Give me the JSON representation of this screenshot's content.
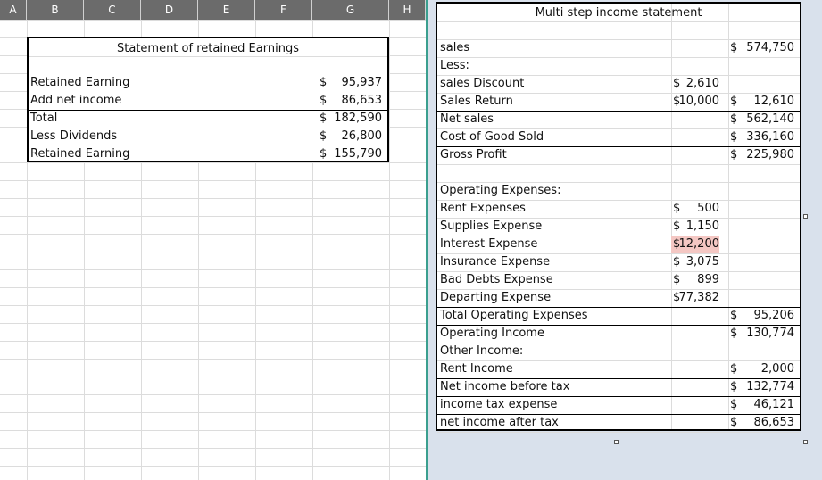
{
  "columns": [
    "A",
    "B",
    "C",
    "D",
    "E",
    "F",
    "G",
    "H"
  ],
  "retained": {
    "title": "Statement of retained Earnings",
    "rows": [
      {
        "label": "Retained Earning",
        "currency": "$",
        "value": "95,937"
      },
      {
        "label": "Add net income",
        "currency": "$",
        "value": "86,653"
      },
      {
        "label": "Total",
        "currency": "$",
        "value": "182,590"
      },
      {
        "label": "Less Dividends",
        "currency": "$",
        "value": "26,800"
      },
      {
        "label": "Retained Earning",
        "currency": "$",
        "value": "155,790"
      }
    ]
  },
  "income": {
    "title": "Multi step income statement",
    "rows": [
      {
        "label": "sales",
        "c1cur": "",
        "c1": "",
        "c2cur": "$",
        "c2": "574,750"
      },
      {
        "label": "Less:",
        "c1cur": "",
        "c1": "",
        "c2cur": "",
        "c2": ""
      },
      {
        "label": "sales Discount",
        "c1cur": "$",
        "c1": "2,610",
        "c2cur": "",
        "c2": ""
      },
      {
        "label": "Sales Return",
        "c1cur": "$",
        "c1": "10,000",
        "c2cur": "$",
        "c2": "12,610"
      },
      {
        "label": "Net sales",
        "c1cur": "",
        "c1": "",
        "c2cur": "$",
        "c2": "562,140"
      },
      {
        "label": "Cost of Good Sold",
        "c1cur": "",
        "c1": "",
        "c2cur": "$",
        "c2": "336,160"
      },
      {
        "label": "Gross Profit",
        "c1cur": "",
        "c1": "",
        "c2cur": "$",
        "c2": "225,980"
      },
      {
        "label": "",
        "c1cur": "",
        "c1": "",
        "c2cur": "",
        "c2": ""
      },
      {
        "label": "Operating Expenses:",
        "c1cur": "",
        "c1": "",
        "c2cur": "",
        "c2": ""
      },
      {
        "label": "Rent Expenses",
        "c1cur": "$",
        "c1": "500",
        "c2cur": "",
        "c2": ""
      },
      {
        "label": "Supplies Expense",
        "c1cur": "$",
        "c1": "1,150",
        "c2cur": "",
        "c2": ""
      },
      {
        "label": "Interest Expense",
        "c1cur": "$",
        "c1": "12,200",
        "c2cur": "",
        "c2": "",
        "highlight": true
      },
      {
        "label": "Insurance Expense",
        "c1cur": "$",
        "c1": "3,075",
        "c2cur": "",
        "c2": ""
      },
      {
        "label": "Bad Debts Expense",
        "c1cur": "$",
        "c1": "899",
        "c2cur": "",
        "c2": ""
      },
      {
        "label": "Departing Expense",
        "c1cur": "$",
        "c1": "77,382",
        "c2cur": "",
        "c2": ""
      },
      {
        "label": "Total Operating Expenses",
        "c1cur": "",
        "c1": "",
        "c2cur": "$",
        "c2": "95,206"
      },
      {
        "label": "Operating Income",
        "c1cur": "",
        "c1": "",
        "c2cur": "$",
        "c2": "130,774"
      },
      {
        "label": "Other Income:",
        "c1cur": "",
        "c1": "",
        "c2cur": "",
        "c2": ""
      },
      {
        "label": "Rent Income",
        "c1cur": "",
        "c1": "",
        "c2cur": "$",
        "c2": "2,000"
      },
      {
        "label": "Net income before tax",
        "c1cur": "",
        "c1": "",
        "c2cur": "$",
        "c2": "132,774"
      },
      {
        "label": "income tax expense",
        "c1cur": "",
        "c1": "",
        "c2cur": "$",
        "c2": "46,121"
      },
      {
        "label": "net income after tax",
        "c1cur": "",
        "c1": "",
        "c2cur": "$",
        "c2": "86,653"
      }
    ]
  }
}
